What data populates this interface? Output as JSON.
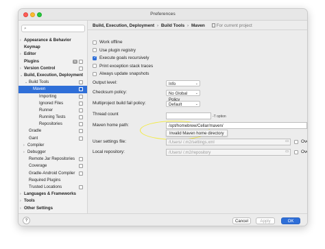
{
  "window": {
    "title": "Preferences"
  },
  "sidebar": {
    "search_placeholder": "",
    "items": [
      {
        "label": "Appearance & Behavior",
        "bold": true,
        "arrow": "›"
      },
      {
        "label": "Keymap",
        "bold": true,
        "arrow": ""
      },
      {
        "label": "Editor",
        "bold": true,
        "arrow": "›"
      },
      {
        "label": "Plugins",
        "bold": true,
        "arrow": "",
        "badge": "5"
      },
      {
        "label": "Version Control",
        "bold": true,
        "arrow": "›"
      },
      {
        "label": "Build, Execution, Deployment",
        "bold": true,
        "arrow": "⌄"
      },
      {
        "label": "Build Tools",
        "bold": false,
        "arrow": "⌄"
      },
      {
        "label": "Maven",
        "bold": false,
        "arrow": "⌄",
        "selected": true
      },
      {
        "label": "Importing",
        "bold": false,
        "arrow": ""
      },
      {
        "label": "Ignored Files",
        "bold": false,
        "arrow": ""
      },
      {
        "label": "Runner",
        "bold": false,
        "arrow": ""
      },
      {
        "label": "Running Tests",
        "bold": false,
        "arrow": ""
      },
      {
        "label": "Repositories",
        "bold": false,
        "arrow": ""
      },
      {
        "label": "Gradle",
        "bold": false,
        "arrow": ""
      },
      {
        "label": "Gant",
        "bold": false,
        "arrow": ""
      },
      {
        "label": "Compiler",
        "bold": false,
        "arrow": "›"
      },
      {
        "label": "Debugger",
        "bold": false,
        "arrow": "›"
      },
      {
        "label": "Remote Jar Repositories",
        "bold": false,
        "arrow": ""
      },
      {
        "label": "Coverage",
        "bold": false,
        "arrow": ""
      },
      {
        "label": "Gradle-Android Compiler",
        "bold": false,
        "arrow": ""
      },
      {
        "label": "Required Plugins",
        "bold": false,
        "arrow": ""
      },
      {
        "label": "Trusted Locations",
        "bold": false,
        "arrow": ""
      },
      {
        "label": "Languages & Frameworks",
        "bold": true,
        "arrow": "›"
      },
      {
        "label": "Tools",
        "bold": true,
        "arrow": "›"
      },
      {
        "label": "Other Settings",
        "bold": true,
        "arrow": "›"
      }
    ]
  },
  "breadcrumb": {
    "items": [
      "Build, Execution, Deployment",
      "Build Tools",
      "Maven"
    ],
    "separator": "›",
    "scope": "For current project"
  },
  "checkboxes": [
    {
      "label": "Work offline",
      "checked": false
    },
    {
      "label": "Use plugin registry",
      "checked": false
    },
    {
      "label": "Execute goals recursively",
      "checked": true
    },
    {
      "label": "Print exception stack traces",
      "checked": false
    },
    {
      "label": "Always update snapshots",
      "checked": false
    }
  ],
  "fields": {
    "output_level": {
      "label": "Output level:",
      "value": "Info"
    },
    "checksum_policy": {
      "label": "Checksum policy:",
      "value": "No Global Policy"
    },
    "fail_policy": {
      "label": "Multiproject build fail policy:",
      "value": "Default"
    },
    "thread_count": {
      "label": "Thread count",
      "value": "",
      "hint": "-T option"
    },
    "maven_home": {
      "label": "Maven home path:",
      "value": "/opt/homebrew/Cellar/maven/",
      "error": "Invalid Maven home directory",
      "browse": "..."
    },
    "user_settings": {
      "label": "User settings file:",
      "value": "/Users/          /.m2/settings.xml",
      "override": "Override"
    },
    "local_repo": {
      "label": "Local repository:",
      "value": "/Users/          /.m2/repository",
      "override": "Override"
    }
  },
  "footer": {
    "help": "?",
    "cancel": "Cancel",
    "apply": "Apply",
    "ok": "OK"
  },
  "colors": {
    "accent": "#2f6fd8",
    "highlight_ring": "#f3ea3a"
  }
}
